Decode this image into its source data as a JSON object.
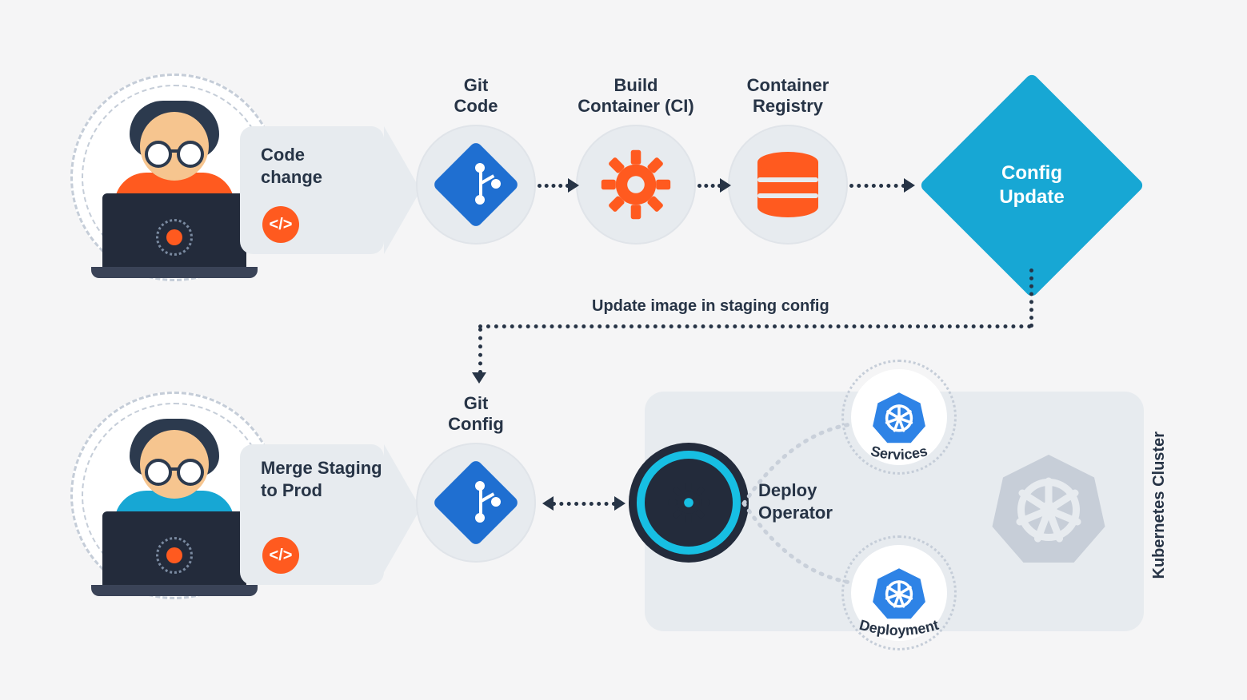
{
  "row1": {
    "panel_label": "Code\nchange",
    "code_chip": "</>",
    "nodes": {
      "git_code": "Git\nCode",
      "build_ci": "Build\nContainer (CI)",
      "registry": "Container\nRegistry"
    },
    "config_update": "Config\nUpdate"
  },
  "connector": {
    "annotation": "Update image in staging config"
  },
  "row2": {
    "panel_label": "Merge\nStaging\nto Prod",
    "code_chip": "</>",
    "git_config_label": "Git\nConfig",
    "deploy_operator": "Deploy\nOperator",
    "services_label": "Services",
    "deployment_label": "Deployment",
    "cluster_label": "Kubernetes Cluster"
  },
  "colors": {
    "orange": "#ff5a1f",
    "blue": "#1f6fd1",
    "cyan": "#17a7d4",
    "dark": "#232b3b",
    "grey": "#e7ebef"
  }
}
